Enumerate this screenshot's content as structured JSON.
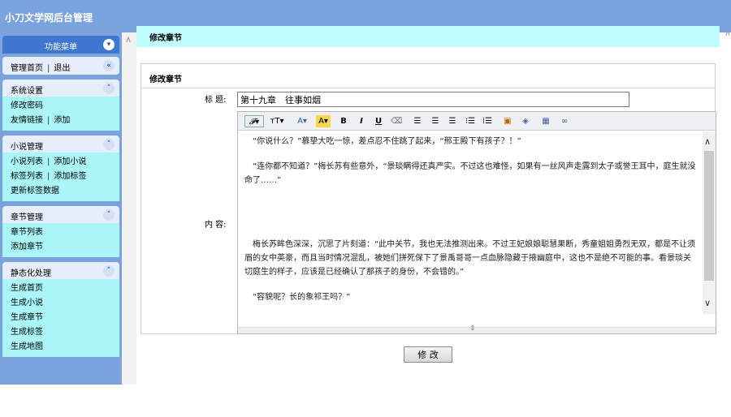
{
  "app": {
    "title": "小刀文学网后台管理"
  },
  "sidebar": {
    "menu_label": "功能菜单",
    "nav": {
      "home": "管理首页",
      "logout": "退出"
    },
    "groups": [
      {
        "title": "系统设置",
        "items": [
          "修改密码",
          "友情链接",
          "添加"
        ]
      },
      {
        "title": "小说管理",
        "items": [
          "小说列表",
          "添加小说",
          "标签列表",
          "添加标签",
          "更新标签数据"
        ]
      },
      {
        "title": "章节管理",
        "items": [
          "章节列表",
          "添加章节"
        ]
      },
      {
        "title": "静态化处理",
        "items": [
          "生成首页",
          "生成小说",
          "生成章节",
          "生成标签",
          "生成地图"
        ]
      }
    ]
  },
  "main": {
    "page_title": "修改章节",
    "panel_title": "修改章节",
    "title_label": "标 题:",
    "title_value": "第十九章　往事如烟",
    "content_label": "内 容:",
    "editor_paragraphs": [
      "“你说什么？”慕挚大吃一惊，差点忍不住跳了起来，“邢王殿下有孩子？！”",
      "“连你都不知道？”梅长苏有些意外，“景琰瞒得还真严实。不过这也难怪，如果有一丝风声走露到太子或誉王耳中，庭生就没命了……”",
      "",
      "梅长苏眸色深深，沉思了片刻道：“此中关节，我也无法推测出来。不过王妃娘娘聪慧果断，秀童姐姐勇烈无双，都是不让须眉的女中英豪，而且当时情况混乱，被她们拼死保下了景禹哥哥一点血脉隐藏于掖幽庭中，这也不是绝不可能的事。看景琰关切庭生的样子，应该是已经确认了那孩子的身份，不会错的。”",
      "“容貌呢？长的象祁王吗？”"
    ],
    "submit_label": "修 改"
  },
  "icons": {
    "toggle_up": "«",
    "toggle_collapse": "⌃"
  }
}
